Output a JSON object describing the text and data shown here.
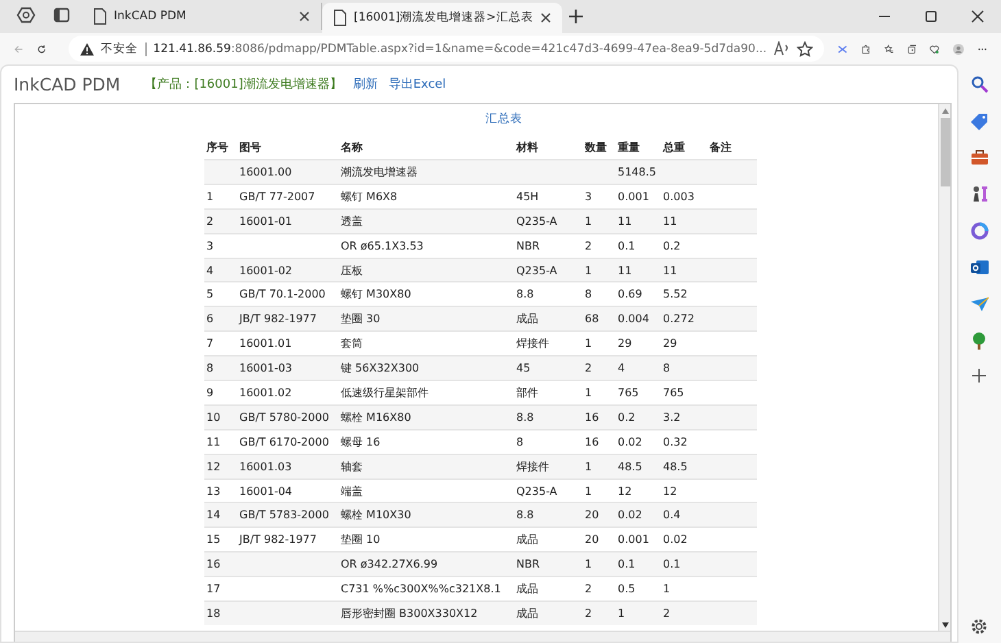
{
  "browser": {
    "tabs": [
      {
        "title": "InkCAD PDM",
        "selected": false
      },
      {
        "title": "[16001]潮流发电增速器>汇总表",
        "selected": true
      }
    ],
    "address": {
      "security": "不安全",
      "host": "121.41.86.59",
      "path": ":8086/pdmapp/PDMTable.aspx?id=1&name=&code=421c47d3-4699-47ea-8ea9-5d7da90..."
    }
  },
  "app": {
    "brand": "InkCAD PDM",
    "product": "【产品：[16001]潮流发电增速器】",
    "links": [
      "刷新",
      "导出Excel"
    ]
  },
  "table": {
    "title": "汇总表",
    "columns": [
      "序号",
      "图号",
      "名称",
      "材料",
      "数量",
      "重量",
      "总重",
      "备注"
    ],
    "rows": [
      {
        "drawing_no": "16001.00",
        "name": "潮流发电增速器",
        "weight": "5148.5"
      },
      {
        "no": "1",
        "drawing_no": "GB/T 77-2007",
        "name": "螺钉 M6X8",
        "material": "45H",
        "qty": "3",
        "weight": "0.001",
        "total": "0.003"
      },
      {
        "no": "2",
        "drawing_no": "16001-01",
        "name": "透盖",
        "material": "Q235-A",
        "qty": "1",
        "weight": "11",
        "total": "11"
      },
      {
        "no": "3",
        "name": "OR ø65.1X3.53",
        "material": "NBR",
        "qty": "2",
        "weight": "0.1",
        "total": "0.2"
      },
      {
        "no": "4",
        "drawing_no": "16001-02",
        "name": "压板",
        "material": "Q235-A",
        "qty": "1",
        "weight": "11",
        "total": "11"
      },
      {
        "no": "5",
        "drawing_no": "GB/T 70.1-2000",
        "name": "螺钉 M30X80",
        "material": "8.8",
        "qty": "8",
        "weight": "0.69",
        "total": "5.52"
      },
      {
        "no": "6",
        "drawing_no": "JB/T 982-1977",
        "name": "垫圈 30",
        "material": "成品",
        "qty": "68",
        "weight": "0.004",
        "total": "0.272"
      },
      {
        "no": "7",
        "drawing_no": "16001.01",
        "name": "套筒",
        "material": "焊接件",
        "qty": "1",
        "weight": "29",
        "total": "29"
      },
      {
        "no": "8",
        "drawing_no": "16001-03",
        "name": "键 56X32X300",
        "material": "45",
        "qty": "2",
        "weight": "4",
        "total": "8"
      },
      {
        "no": "9",
        "drawing_no": "16001.02",
        "name": "低速级行星架部件",
        "material": "部件",
        "qty": "1",
        "weight": "765",
        "total": "765"
      },
      {
        "no": "10",
        "drawing_no": "GB/T 5780-2000",
        "name": "螺栓 M16X80",
        "material": "8.8",
        "qty": "16",
        "weight": "0.2",
        "total": "3.2"
      },
      {
        "no": "11",
        "drawing_no": "GB/T 6170-2000",
        "name": "螺母 16",
        "material": "8",
        "qty": "16",
        "weight": "0.02",
        "total": "0.32"
      },
      {
        "no": "12",
        "drawing_no": "16001.03",
        "name": "轴套",
        "material": "焊接件",
        "qty": "1",
        "weight": "48.5",
        "total": "48.5"
      },
      {
        "no": "13",
        "drawing_no": "16001-04",
        "name": "端盖",
        "material": "Q235-A",
        "qty": "1",
        "weight": "12",
        "total": "12"
      },
      {
        "no": "14",
        "drawing_no": "GB/T 5783-2000",
        "name": "螺栓 M10X30",
        "material": "8.8",
        "qty": "20",
        "weight": "0.02",
        "total": "0.4"
      },
      {
        "no": "15",
        "drawing_no": "JB/T 982-1977",
        "name": "垫圈 10",
        "material": "成品",
        "qty": "20",
        "weight": "0.001",
        "total": "0.02"
      },
      {
        "no": "16",
        "name": "OR ø342.27X6.99",
        "material": "NBR",
        "qty": "1",
        "weight": "0.1",
        "total": "0.1"
      },
      {
        "no": "17",
        "name": "C731 %%c300X%%c321X8.1",
        "material": "成品",
        "qty": "2",
        "weight": "0.5",
        "total": "1"
      },
      {
        "no": "18",
        "name": "唇形密封圈 B300X330X12",
        "material": "成品",
        "qty": "2",
        "weight": "1",
        "total": "2"
      }
    ]
  }
}
